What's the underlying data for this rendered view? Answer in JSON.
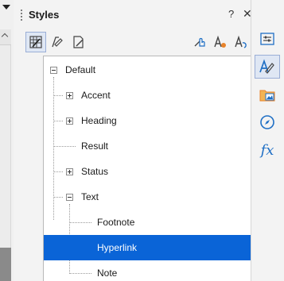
{
  "panel": {
    "title": "Styles",
    "help_label": "?",
    "close_label": "✕",
    "menu_label": "≡"
  },
  "toolbar": {
    "left_buttons": [
      {
        "name": "paragraph-styles-button",
        "icon": "paragraph-styles-icon",
        "active": true
      },
      {
        "name": "character-styles-button",
        "icon": "character-styles-icon",
        "active": false
      },
      {
        "name": "frame-styles-button",
        "icon": "frame-styles-icon",
        "active": false
      }
    ],
    "right_buttons": [
      {
        "name": "fill-format-mode-button",
        "icon": "fill-format-icon"
      },
      {
        "name": "new-style-button",
        "icon": "new-style-icon"
      },
      {
        "name": "update-style-button",
        "icon": "update-style-icon"
      }
    ]
  },
  "tree": {
    "items": [
      {
        "label": "Default",
        "level": 0,
        "expander": "minus"
      },
      {
        "label": "Accent",
        "level": 1,
        "expander": "plus"
      },
      {
        "label": "Heading",
        "level": 1,
        "expander": "plus"
      },
      {
        "label": "Result",
        "level": 1,
        "expander": "none"
      },
      {
        "label": "Status",
        "level": 1,
        "expander": "plus"
      },
      {
        "label": "Text",
        "level": 1,
        "expander": "minus"
      },
      {
        "label": "Footnote",
        "level": 2,
        "expander": "none"
      },
      {
        "label": "Hyperlink",
        "level": 2,
        "expander": "none",
        "selected": true
      },
      {
        "label": "Note",
        "level": 2,
        "expander": "none"
      }
    ]
  },
  "sidebar": {
    "buttons": [
      {
        "name": "properties-deck-button",
        "icon": "properties-icon"
      },
      {
        "name": "styles-deck-button",
        "icon": "styles-icon",
        "active": true
      },
      {
        "name": "gallery-deck-button",
        "icon": "gallery-icon"
      },
      {
        "name": "navigator-deck-button",
        "icon": "navigator-icon"
      },
      {
        "name": "functions-deck-button",
        "icon": "functions-icon",
        "glyph": "fx"
      }
    ]
  },
  "colors": {
    "selection": "#0a64d7",
    "accent_blue": "#1f6fc5",
    "accent_orange": "#e8832a"
  }
}
